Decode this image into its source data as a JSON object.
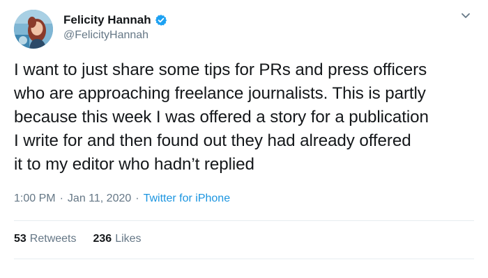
{
  "tweet": {
    "author": {
      "display_name": "Felicity Hannah",
      "handle": "@FelicityHannah",
      "verified": true,
      "avatar_icon": "profile-photo"
    },
    "text": "I want to just share some tips for PRs and press officers\nwho are approaching freelance journalists. This is partly\nbecause this week I was offered a story for a publication\nI write for and then found out they had already offered\nit to my editor who hadn’t replied",
    "time": "1:00 PM",
    "separator": "·",
    "date": "Jan 11, 2020",
    "source": "Twitter for iPhone",
    "stats": {
      "retweets_count": "53",
      "retweets_label": "Retweets",
      "likes_count": "236",
      "likes_label": "Likes"
    }
  },
  "colors": {
    "text_primary": "#14171a",
    "text_secondary": "#657786",
    "link": "#1b95e0",
    "verified": "#1da1f2",
    "divider": "#e6ecf0"
  }
}
